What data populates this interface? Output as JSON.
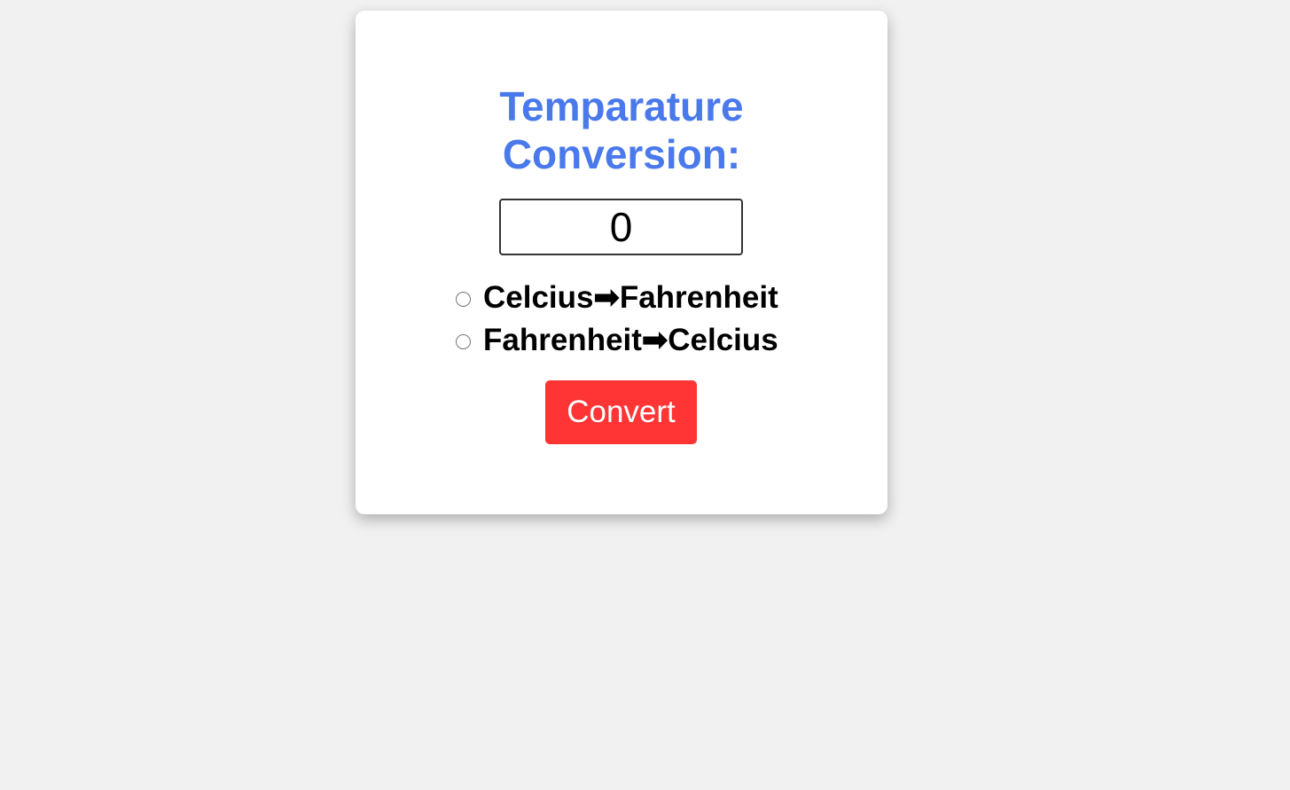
{
  "card": {
    "title_line1": "Temparature",
    "title_line2": "Conversion:"
  },
  "input": {
    "value": "0"
  },
  "options": [
    {
      "label": "Celcius➡Fahrenheit",
      "selected": false
    },
    {
      "label": "Fahrenheit➡Celcius",
      "selected": false
    }
  ],
  "button": {
    "label": "Convert"
  },
  "colors": {
    "background": "#f1f1f1",
    "title": "#4a79ec",
    "button": "#ff3535",
    "button_text": "#ffffff"
  }
}
